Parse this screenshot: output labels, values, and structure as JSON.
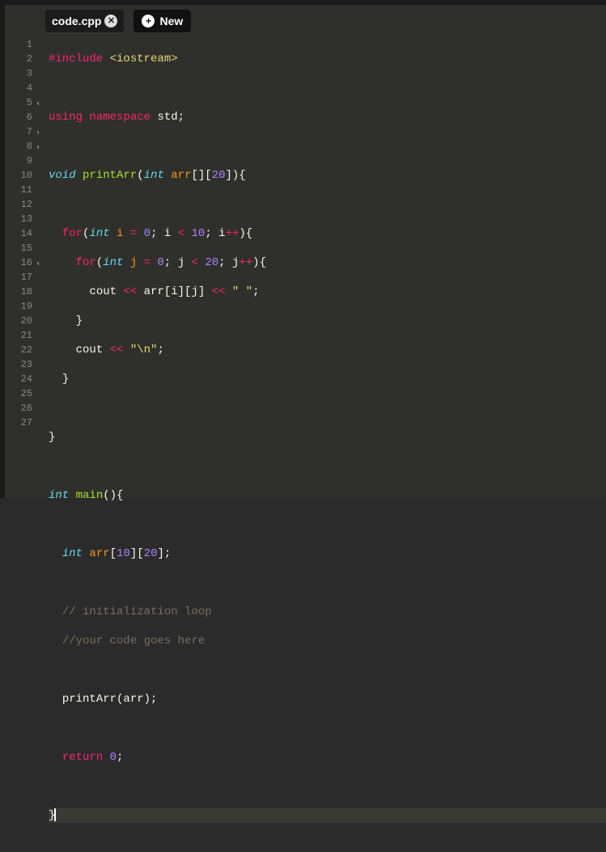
{
  "tabs": {
    "active": {
      "label": "code.cpp"
    },
    "newButton": {
      "label": "New"
    }
  },
  "lineNumbers": [
    1,
    2,
    3,
    4,
    5,
    6,
    7,
    8,
    9,
    10,
    11,
    12,
    13,
    14,
    15,
    16,
    17,
    18,
    19,
    20,
    21,
    22,
    23,
    24,
    25,
    26,
    27
  ],
  "foldLines": [
    5,
    7,
    8,
    16
  ],
  "activeLine": 27,
  "code": {
    "l1": {
      "pre": "#include",
      "inc": " <iostream>"
    },
    "l3": {
      "kw1": "using",
      "kw2": "namespace",
      "id": " std",
      "pn": ";"
    },
    "l5": {
      "ty": "void",
      "fn": " printArr",
      "p1": "(",
      "ty2": "int",
      "var": " arr",
      "br": "[][",
      "num": "20",
      "p2": "]){"
    },
    "l7": {
      "kw": "for",
      "p1": "(",
      "ty": "int",
      "var": " i ",
      "op1": "=",
      "sp1": " ",
      "n1": "0",
      "pn1": "; ",
      "id2": "i ",
      "op2": "<",
      "sp2": " ",
      "n2": "10",
      "pn2": "; ",
      "id3": "i",
      "op3": "++",
      "p2": "){"
    },
    "l8": {
      "kw": "for",
      "p1": "(",
      "ty": "int",
      "var": " j ",
      "op1": "=",
      "sp1": " ",
      "n1": "0",
      "pn1": "; ",
      "id2": "j ",
      "op2": "<",
      "sp2": " ",
      "n2": "20",
      "pn2": "; ",
      "id3": "j",
      "op3": "++",
      "p2": "){"
    },
    "l9": {
      "id1": "cout ",
      "op1": "<<",
      "id2": " arr[i][j] ",
      "op2": "<<",
      "sp": " ",
      "str": "\" \"",
      "pn": ";"
    },
    "l10": {
      "pn": "}"
    },
    "l11": {
      "id1": "cout ",
      "op1": "<<",
      "sp": " ",
      "str": "\"\\n\"",
      "pn": ";"
    },
    "l12": {
      "pn": "}"
    },
    "l14": {
      "pn": "}"
    },
    "l16": {
      "ty": "int",
      "fn": " main",
      "p": "(){"
    },
    "l18": {
      "ty": "int",
      "var": " arr",
      "p1": "[",
      "n1": "10",
      "p2": "][",
      "n2": "20",
      "p3": "];"
    },
    "l20": {
      "cm": "// initialization loop"
    },
    "l21": {
      "cm": "//your code goes here"
    },
    "l23": {
      "id": "printArr(arr)",
      "pn": ";"
    },
    "l25": {
      "kw": "return",
      "sp": " ",
      "n": "0",
      "pn": ";"
    },
    "l27": {
      "pn": "}"
    }
  }
}
